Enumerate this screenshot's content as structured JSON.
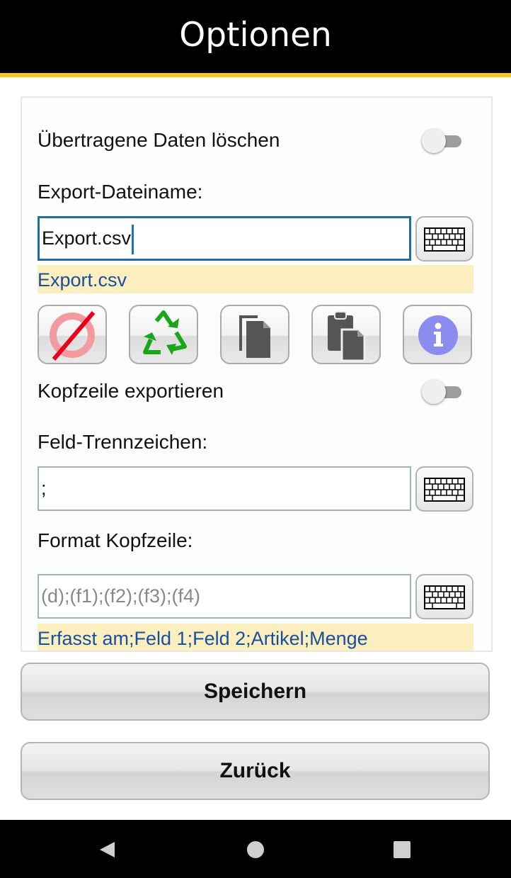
{
  "header": {
    "title": "Optionen"
  },
  "options": {
    "delete_transferred": {
      "label": "Übertragene Daten löschen",
      "enabled": false
    },
    "export_filename": {
      "label": "Export-Dateiname:",
      "value": "Export.csv",
      "preview": "Export.csv"
    },
    "action_buttons": [
      {
        "name": "clear",
        "icon": "no-symbol-icon"
      },
      {
        "name": "reset",
        "icon": "recycle-icon"
      },
      {
        "name": "copy",
        "icon": "copy-icon"
      },
      {
        "name": "paste",
        "icon": "paste-icon"
      },
      {
        "name": "info",
        "icon": "info-icon"
      }
    ],
    "export_header": {
      "label": "Kopfzeile exportieren",
      "enabled": false
    },
    "field_separator": {
      "label": "Feld-Trennzeichen:",
      "value": ";"
    },
    "header_format": {
      "label": "Format Kopfzeile:",
      "placeholder": "(d);(f1);(f2);(f3);(f4)",
      "preview": "Erfasst am;Feld 1;Feld 2;Artikel;Menge"
    }
  },
  "buttons": {
    "save": "Speichern",
    "back": "Zurück"
  },
  "navbar": {
    "back": "back-icon",
    "home": "home-icon",
    "recents": "recents-icon"
  },
  "colors": {
    "accent": "#f5c518",
    "hint_background": "#fcefbf",
    "hint_text": "#1a4fa0",
    "focus_border": "#1d6ea6"
  }
}
